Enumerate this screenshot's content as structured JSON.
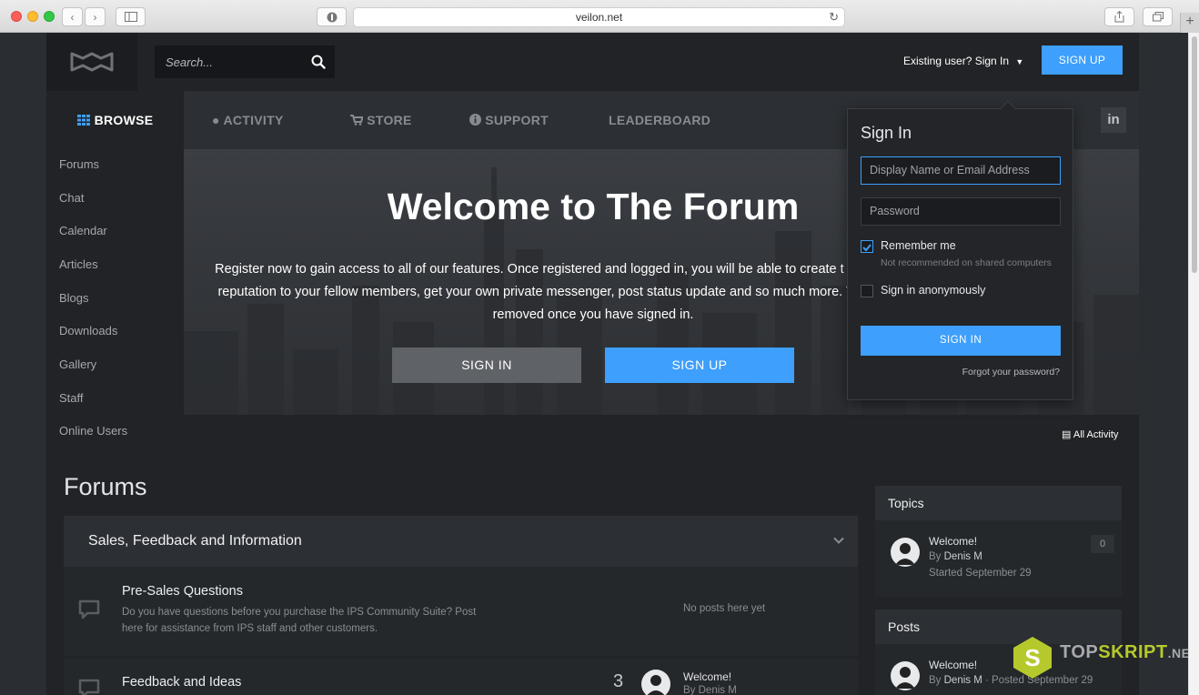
{
  "browser": {
    "url": "veilon.net"
  },
  "header": {
    "search_placeholder": "Search...",
    "signin_link": "Existing user? Sign In",
    "signup_label": "SIGN UP"
  },
  "nav": {
    "browse": "BROWSE",
    "items": [
      "ACTIVITY",
      "STORE",
      "SUPPORT",
      "LEADERBOARD"
    ],
    "social": [
      "in"
    ]
  },
  "sidebar": {
    "items": [
      "Forums",
      "Chat",
      "Calendar",
      "Articles",
      "Blogs",
      "Downloads",
      "Gallery",
      "Staff",
      "Online Users"
    ]
  },
  "hero": {
    "title": "Welcome to The Forum",
    "text": "Register now to gain access to all of our features. Once registered and logged in, you will be able to create t existing threads, give reputation to your fellow members, get your own private messenger, post status update and so much more. This message will be removed once you have signed in.",
    "signin_label": "SIGN IN",
    "signup_label": "SIGN UP"
  },
  "activity_link": "All Activity",
  "forums": {
    "title": "Forums",
    "category": "Sales, Feedback and Information",
    "rows": [
      {
        "name": "Pre-Sales Questions",
        "desc": "Do you have questions before you purchase the IPS Community Suite? Post here for assistance from IPS staff and other customers.",
        "last": "No posts here yet"
      },
      {
        "name": "Feedback and Ideas",
        "count": "3",
        "last_title": "Welcome!",
        "last_by": "By Denis M"
      }
    ]
  },
  "topics_widget": {
    "title": "Topics",
    "item_title": "Welcome!",
    "item_by_prefix": "By",
    "item_by": "Denis M",
    "item_started": "Started September 29",
    "item_count": "0"
  },
  "posts_widget": {
    "title": "Posts",
    "item_title": "Welcome!",
    "item_by_prefix": "By",
    "item_by": "Denis M",
    "item_posted": "· Posted September 29"
  },
  "signin_dropdown": {
    "title": "Sign In",
    "username_placeholder": "Display Name or Email Address",
    "password_placeholder": "Password",
    "remember_label": "Remember me",
    "remember_hint": "Not recommended on shared computers",
    "remember_checked": true,
    "anon_label": "Sign in anonymously",
    "anon_checked": false,
    "submit_label": "SIGN IN",
    "forgot_label": "Forgot your password?"
  },
  "watermark": {
    "part1": "TOP",
    "part2": "SKRIPT",
    "part3": ".NET"
  },
  "colors": {
    "accent": "#3e9ffc",
    "background": "#212326"
  }
}
